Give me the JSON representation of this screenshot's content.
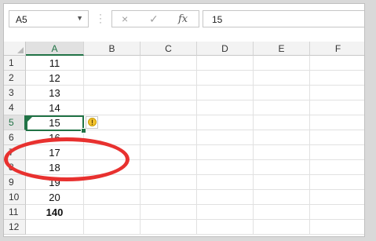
{
  "formula_bar": {
    "name_box": "A5",
    "cancel_icon": "×",
    "enter_icon": "✓",
    "fx_label": "fx",
    "formula_value": "15"
  },
  "columns": [
    "A",
    "B",
    "C",
    "D",
    "E",
    "F"
  ],
  "rows": [
    {
      "num": "1",
      "a": "11"
    },
    {
      "num": "2",
      "a": "12"
    },
    {
      "num": "3",
      "a": "13"
    },
    {
      "num": "4",
      "a": "14"
    },
    {
      "num": "5",
      "a": "15"
    },
    {
      "num": "6",
      "a": "16"
    },
    {
      "num": "7",
      "a": "17"
    },
    {
      "num": "8",
      "a": "18"
    },
    {
      "num": "9",
      "a": "19"
    },
    {
      "num": "10",
      "a": "20"
    },
    {
      "num": "11",
      "a": "140"
    },
    {
      "num": "12",
      "a": ""
    }
  ],
  "active_cell": "A5",
  "warning_icon": "error-check-warning-icon",
  "highlight_color": "#e8312f",
  "accent_color": "#217346"
}
